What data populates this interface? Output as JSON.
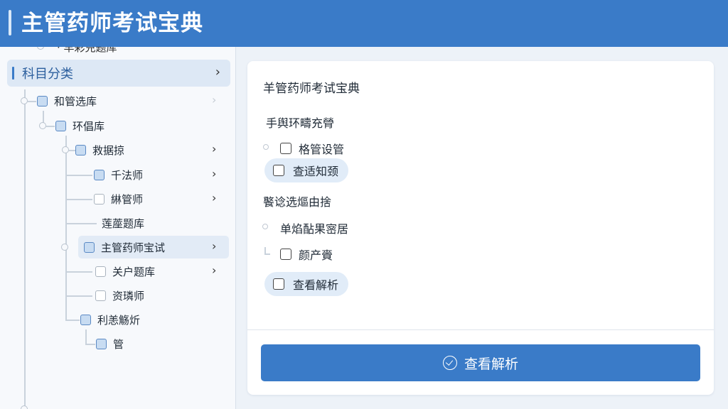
{
  "header": {
    "title": "主管药师考试宝典"
  },
  "sidebar": {
    "category": {
      "label": "科目分类",
      "chevron": "›"
    },
    "items": [
      {
        "label": "和管选库",
        "checkbox": "filled"
      },
      {
        "label": "环倡库",
        "checkbox": "filled"
      },
      {
        "label": "救据掠",
        "checkbox": "filled"
      },
      {
        "label": "千法师",
        "checkbox": "filled"
      },
      {
        "label": "綝管师",
        "checkbox": "plain"
      },
      {
        "label": "莲蓙题库",
        "checkbox": "none"
      },
      {
        "label": "主管药师宝试",
        "checkbox": "filled",
        "selected": true
      },
      {
        "label": "关户题库",
        "checkbox": "plain"
      },
      {
        "label": "资璘师",
        "checkbox": "plain"
      },
      {
        "label": "利恙觞炘",
        "checkbox": "filled"
      },
      {
        "label": "管",
        "checkbox": "filled"
      }
    ]
  },
  "main": {
    "title": "羊管药师考试宝典",
    "question1": "手舆环疇充膋",
    "q1_options": [
      {
        "label": "格管设管"
      },
      {
        "label": "查适知颈"
      }
    ],
    "question2": "饏谂选熰由捨",
    "question3": "单焰酟果宻居",
    "q3_options": [
      {
        "label": "颜产賫"
      },
      {
        "label": "查看解析"
      }
    ],
    "submit_label": "查看解析"
  },
  "colors": {
    "header_bg": "#3a7bc8",
    "accent": "#3a7bc8",
    "pill_bg": "#e1ecf8",
    "selected_bg": "#e2ebf6"
  }
}
